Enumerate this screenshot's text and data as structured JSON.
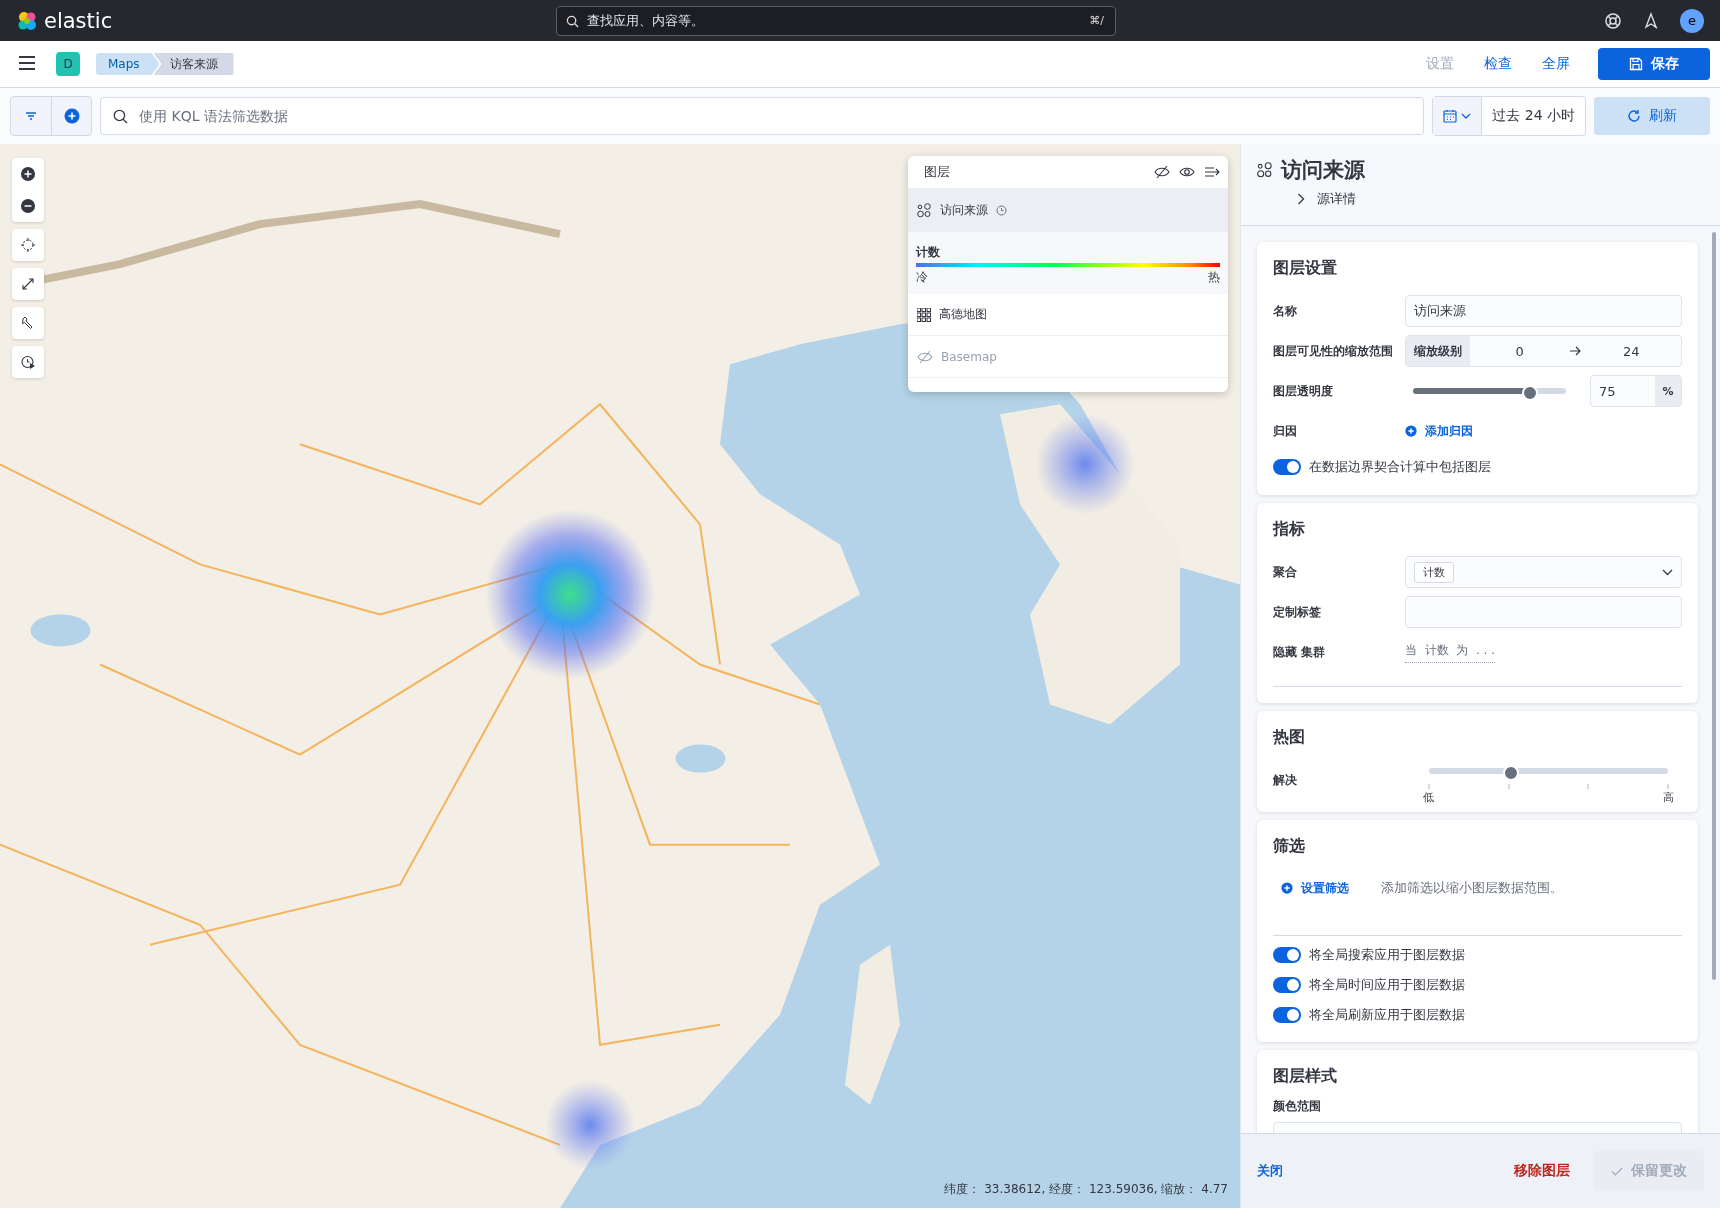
{
  "topbar": {
    "logo_text": "elastic",
    "search_placeholder": "查找应用、内容等。",
    "shortcut": "⌘/",
    "avatar": "e"
  },
  "appbar": {
    "space": "D",
    "breadcrumbs": [
      {
        "label": "Maps"
      },
      {
        "label": "访客来源"
      }
    ],
    "actions": [
      {
        "label": "设置",
        "disabled": true
      },
      {
        "label": "检查",
        "disabled": false
      },
      {
        "label": "全屏",
        "disabled": false
      }
    ],
    "save": "保存"
  },
  "filterbar": {
    "query_placeholder": "使用 KQL 语法筛选数据",
    "time_range": "过去 24 小时",
    "refresh": "刷新"
  },
  "map": {
    "kind": "picture",
    "coordinates": "纬度： 33.38612, 经度： 123.59036, 缩放： 4.77"
  },
  "layers_panel": {
    "title": "图层",
    "layers": [
      {
        "name": "访问来源",
        "kind": "heatmap",
        "selected": true,
        "visible": true,
        "legend": {
          "title": "计数",
          "low": "冷",
          "high": "热"
        }
      },
      {
        "name": "高德地图",
        "kind": "tiles",
        "selected": false,
        "visible": true
      },
      {
        "name": "Basemap",
        "kind": "tiles",
        "selected": false,
        "visible": false
      }
    ]
  },
  "editor": {
    "title": "访问来源",
    "subtitle": "源详情",
    "settings": {
      "title": "图层设置",
      "name_label": "名称",
      "name_value": "访问来源",
      "zoom_label": "图层可见性的缩放范围",
      "zoom_prefix": "缩放级别",
      "zoom_min": "0",
      "zoom_max": "24",
      "opacity_label": "图层透明度",
      "opacity": {
        "level": 0.75,
        "value": "75",
        "unit": "%"
      },
      "attribution_label": "归因",
      "attribution_action": "添加归因",
      "bounds_toggle": {
        "label": "在数据边界契合计算中包括图层",
        "checked": true
      }
    },
    "metrics": {
      "title": "指标",
      "aggregation_label": "聚合",
      "aggregation_value": "计数",
      "custom_label_label": "定制标签",
      "hide_label": "隐藏 集群",
      "hide_value": "当  计数  为  . . ."
    },
    "heatmap": {
      "title": "热图",
      "resolution_label": "解决",
      "resolution": {
        "level": 0.333,
        "low": "低",
        "high": "高"
      }
    },
    "filters": {
      "title": "筛选",
      "action": "设置筛选",
      "hint": "添加筛选以缩小图层数据范围。",
      "toggles": [
        {
          "label": "将全局搜索应用于图层数据",
          "checked": true
        },
        {
          "label": "将全局时间应用于图层数据",
          "checked": true
        },
        {
          "label": "将全局刷新应用于图层数据",
          "checked": true
        }
      ]
    },
    "style": {
      "title": "图层样式",
      "color_range_label": "颜色范围"
    },
    "footer": {
      "close": "关闭",
      "remove": "移除图层",
      "keep": {
        "label": "保留更改",
        "disabled": true
      }
    }
  }
}
